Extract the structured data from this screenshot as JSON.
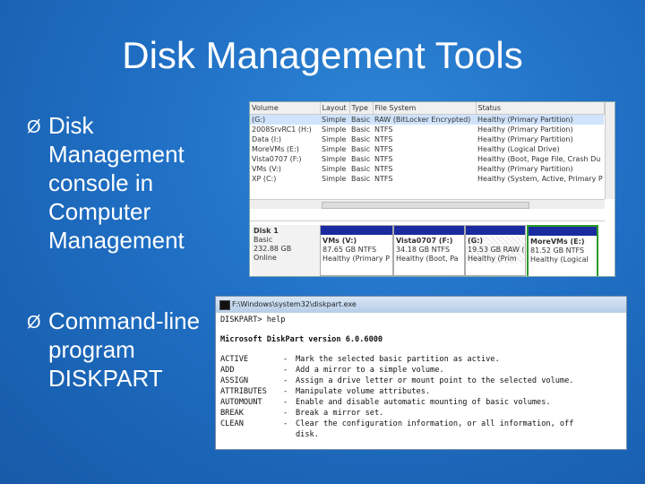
{
  "slide": {
    "title": "Disk Management Tools",
    "bullets": [
      {
        "arrow": "Ø",
        "text": "Disk Management console in Computer Management"
      },
      {
        "arrow": "Ø",
        "text": "Command-line program DISKPART"
      }
    ]
  },
  "disk_mgmt": {
    "columns": [
      "Volume",
      "Layout",
      "Type",
      "File System",
      "Status"
    ],
    "rows": [
      [
        "(G:)",
        "Simple",
        "Basic",
        "RAW (BitLocker Encrypted)",
        "Healthy (Primary Partition)"
      ],
      [
        "2008SrvRC1 (H:)",
        "Simple",
        "Basic",
        "NTFS",
        "Healthy (Primary Partition)"
      ],
      [
        "Data (I:)",
        "Simple",
        "Basic",
        "NTFS",
        "Healthy (Primary Partition)"
      ],
      [
        "MoreVMs (E:)",
        "Simple",
        "Basic",
        "NTFS",
        "Healthy (Logical Drive)"
      ],
      [
        "Vista0707 (F:)",
        "Simple",
        "Basic",
        "NTFS",
        "Healthy (Boot, Page File, Crash Du"
      ],
      [
        "VMs (V:)",
        "Simple",
        "Basic",
        "NTFS",
        "Healthy (Primary Partition)"
      ],
      [
        "XP (C:)",
        "Simple",
        "Basic",
        "NTFS",
        "Healthy (System, Active, Primary P"
      ]
    ],
    "disk": {
      "name": "Disk 1",
      "type": "Basic",
      "size": "232.88 GB",
      "state": "Online",
      "partitions": [
        {
          "name": "VMs (V:)",
          "size": "87.65 GB NTFS",
          "status": "Healthy (Primary P"
        },
        {
          "name": "Vista0707 (F:)",
          "size": "34.18 GB NTFS",
          "status": "Healthy (Boot, Pa"
        },
        {
          "name": "(G:)",
          "size": "19.53 GB RAW (",
          "status": "Healthy (Prim"
        },
        {
          "name": "MoreVMs (E:)",
          "size": "81.52 GB NTFS",
          "status": "Healthy (Logical"
        }
      ]
    }
  },
  "cmd": {
    "title": "F:\\Windows\\system32\\diskpart.exe",
    "prompt": "DISKPART> help",
    "version": "Microsoft DiskPart version 6.0.6000",
    "commands": [
      [
        "ACTIVE",
        "-",
        "Mark the selected basic partition as active."
      ],
      [
        "ADD",
        "-",
        "Add a mirror to a simple volume."
      ],
      [
        "ASSIGN",
        "-",
        "Assign a drive letter or mount point to the selected volume."
      ],
      [
        "ATTRIBUTES",
        "-",
        "Manipulate volume attributes."
      ],
      [
        "AUTOMOUNT",
        "-",
        "Enable and disable automatic mounting of basic volumes."
      ],
      [
        "BREAK",
        "-",
        "Break a mirror set."
      ],
      [
        "CLEAN",
        "-",
        "Clear the configuration information, or all information, off"
      ],
      [
        "",
        "",
        "disk."
      ]
    ]
  }
}
